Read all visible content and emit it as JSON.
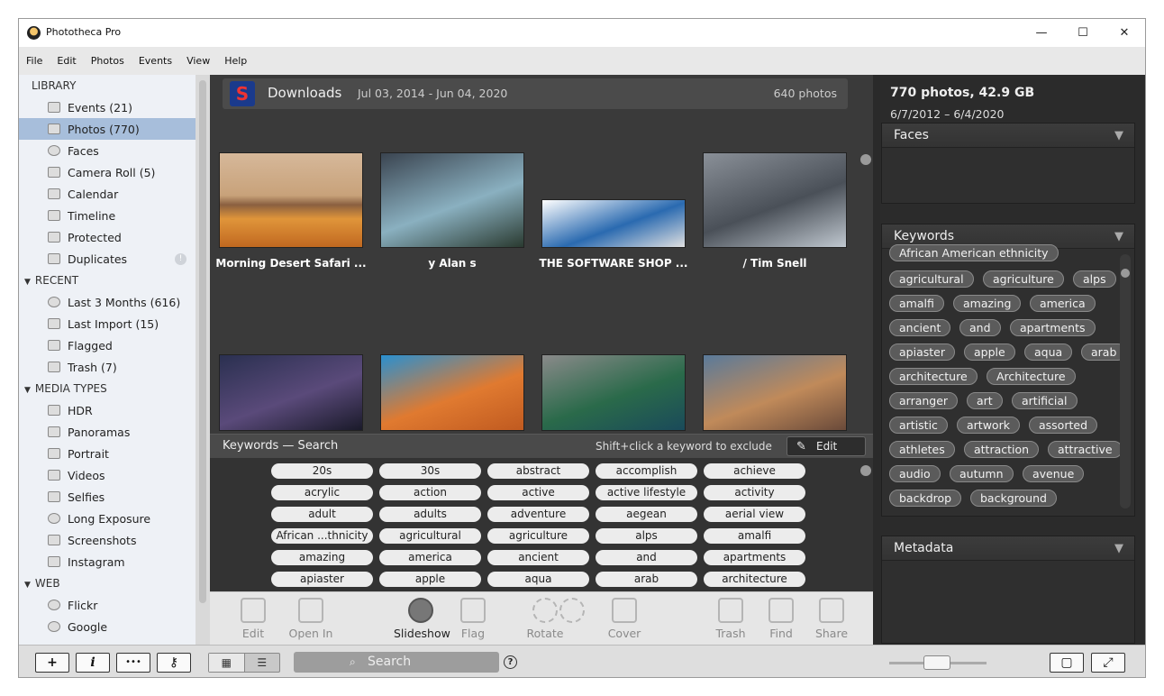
{
  "window": {
    "title": "Phototheca Pro",
    "controls": {
      "minimize": "—",
      "maximize": "☐",
      "close": "✕"
    }
  },
  "menu": [
    "File",
    "Edit",
    "Photos",
    "Events",
    "View",
    "Help"
  ],
  "sidebar": {
    "library_header": "LIBRARY",
    "library": [
      "Events (21)",
      "Photos (770)",
      "Faces",
      "Camera Roll (5)",
      "Calendar",
      "Timeline",
      "Protected",
      "Duplicates"
    ],
    "recent_header": "RECENT",
    "recent": [
      "Last 3 Months (616)",
      "Last Import (15)",
      "Flagged",
      "Trash (7)"
    ],
    "media_header": "MEDIA TYPES",
    "media": [
      "HDR",
      "Panoramas",
      "Portrait",
      "Videos",
      "Selfies",
      "Long Exposure",
      "Screenshots",
      "Instagram"
    ],
    "web_header": "WEB",
    "web": [
      "Flickr",
      "Google"
    ]
  },
  "event": {
    "name": "Downloads",
    "dates": "Jul 03, 2014 - Jun 04, 2020",
    "count": "640 photos"
  },
  "thumbnails": [
    {
      "caption": "Morning Desert Safari ...",
      "colors": [
        "#c89a6a",
        "#8a6a4a",
        "#e09a3a"
      ]
    },
    {
      "caption": "y Alan s",
      "colors": [
        "#3a4450",
        "#8ab0c0",
        "#2a3a30"
      ]
    },
    {
      "caption": "THE SOFTWARE SHOP ...",
      "colors": [
        "#ffffff",
        "#2a6ab0",
        "#e0e0e0"
      ]
    },
    {
      "caption": "/ Tim Snell",
      "colors": [
        "#8a9098",
        "#4a5058",
        "#c0c8d0"
      ]
    },
    {
      "caption": "",
      "colors": [
        "#2a3050",
        "#5a4a7a",
        "#1a1a2a"
      ]
    },
    {
      "caption": "",
      "colors": [
        "#2a90d0",
        "#e07a30",
        "#c05a20"
      ]
    },
    {
      "caption": "",
      "colors": [
        "#8a8a8a",
        "#2a6a4a",
        "#1a4a5a"
      ]
    },
    {
      "caption": "",
      "colors": [
        "#5a7a9a",
        "#c08a5a",
        "#6a4a3a"
      ]
    }
  ],
  "keywords_bar": {
    "title": "Keywords — Search",
    "hint": "Shift+click a keyword to exclude",
    "edit": "Edit"
  },
  "keyword_chips": [
    "20s",
    "30s",
    "abstract",
    "accomplish",
    "achieve",
    "acrylic",
    "action",
    "active",
    "active lifestyle",
    "activity",
    "adult",
    "adults",
    "adventure",
    "aegean",
    "aerial view",
    "African ...thnicity",
    "agricultural",
    "agriculture",
    "alps",
    "amalfi",
    "amazing",
    "america",
    "ancient",
    "and",
    "apartments",
    "apiaster",
    "apple",
    "aqua",
    "arab",
    "architecture"
  ],
  "toolbar": [
    "Edit",
    "Open In",
    "Slideshow",
    "Flag",
    "Rotate",
    "Rotate",
    "Cover",
    "Trash",
    "Find",
    "Share"
  ],
  "info": {
    "summary": "770 photos, 42.9 GB",
    "range": "6/7/2012 – 6/4/2020"
  },
  "panels": {
    "faces": "Faces",
    "keywords": "Keywords",
    "metadata": "Metadata",
    "toggle": "▼"
  },
  "right_keywords_partial": "African American ethnicity",
  "right_keywords": [
    [
      "agricultural",
      "agriculture",
      "alps"
    ],
    [
      "amalfi",
      "amazing",
      "america"
    ],
    [
      "ancient",
      "and",
      "apartments"
    ],
    [
      "apiaster",
      "apple",
      "aqua",
      "arab"
    ],
    [
      "architecture",
      "Architecture"
    ],
    [
      "arranger",
      "art",
      "artificial"
    ],
    [
      "artistic",
      "artwork",
      "assorted"
    ],
    [
      "athletes",
      "attraction",
      "attractive"
    ],
    [
      "audio",
      "autumn",
      "avenue"
    ],
    [
      "backdrop",
      "background"
    ]
  ],
  "bottom": {
    "add": "+",
    "info": "i",
    "more": "•••",
    "key": "⚷",
    "view_grid": "▦",
    "view_list": "☰",
    "search": "Search",
    "help": "?",
    "fit": "▢",
    "fullscreen": "⤢"
  }
}
